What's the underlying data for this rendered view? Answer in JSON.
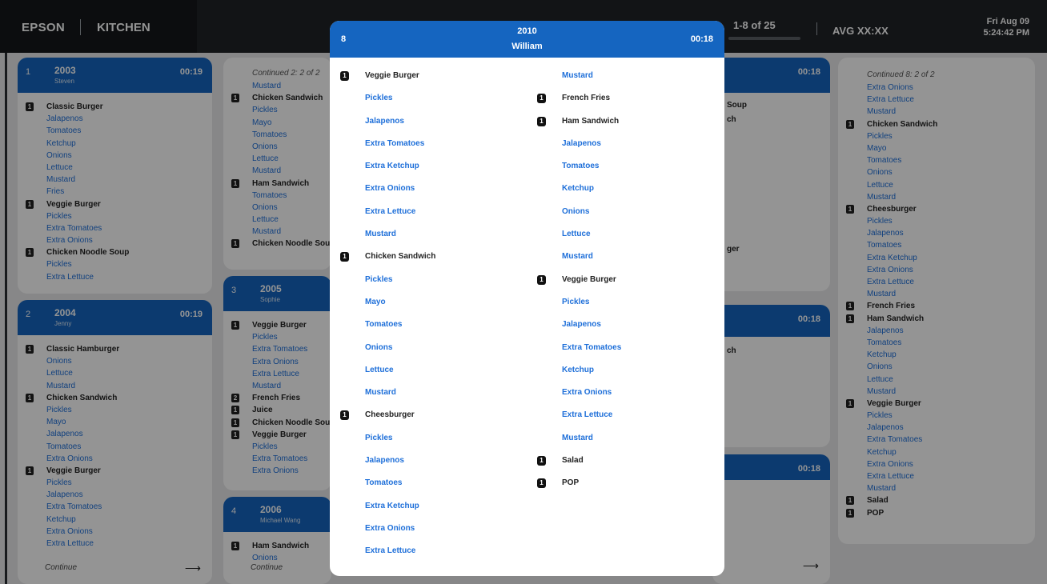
{
  "header": {
    "brand": "EPSON",
    "station": "KITCHEN",
    "pager": "1-8 of 25",
    "avg": "AVG XX:XX",
    "date": "Fri Aug 09",
    "time": "5:24:42 PM"
  },
  "tickets": {
    "t2003": {
      "index": "1",
      "number": "2003",
      "name": "Steven",
      "timer": "00:19",
      "lines": [
        {
          "type": "item",
          "qty": "1",
          "text": "Classic Burger"
        },
        {
          "type": "mod",
          "text": "Jalapenos"
        },
        {
          "type": "mod",
          "text": "Tomatoes"
        },
        {
          "type": "mod",
          "text": "Ketchup"
        },
        {
          "type": "mod",
          "text": "Onions"
        },
        {
          "type": "mod",
          "text": "Lettuce"
        },
        {
          "type": "mod",
          "text": "Mustard"
        },
        {
          "type": "mod",
          "text": "Fries"
        },
        {
          "type": "item",
          "qty": "1",
          "text": "Veggie Burger"
        },
        {
          "type": "mod",
          "text": "Pickles"
        },
        {
          "type": "mod",
          "text": "Extra Tomatoes"
        },
        {
          "type": "mod",
          "text": "Extra Onions"
        },
        {
          "type": "item",
          "qty": "1",
          "text": "Chicken Noodle Soup"
        },
        {
          "type": "mod",
          "text": "Pickles"
        },
        {
          "type": "mod",
          "text": "Extra Lettuce"
        }
      ]
    },
    "t2004": {
      "index": "2",
      "number": "2004",
      "name": "Jenny",
      "timer": "00:19",
      "continue_label": "Continue",
      "arrow": "⟶",
      "lines": [
        {
          "type": "item",
          "qty": "1",
          "text": "Classic Hamburger"
        },
        {
          "type": "mod",
          "text": "Onions"
        },
        {
          "type": "mod",
          "text": "Lettuce"
        },
        {
          "type": "mod",
          "text": "Mustard"
        },
        {
          "type": "item",
          "qty": "1",
          "text": "Chicken Sandwich"
        },
        {
          "type": "mod",
          "text": "Pickles"
        },
        {
          "type": "mod",
          "text": "Mayo"
        },
        {
          "type": "mod",
          "text": "Jalapenos"
        },
        {
          "type": "mod",
          "text": "Tomatoes"
        },
        {
          "type": "mod",
          "text": "Extra Onions"
        },
        {
          "type": "item",
          "qty": "1",
          "text": "Veggie Burger"
        },
        {
          "type": "mod",
          "text": "Pickles"
        },
        {
          "type": "mod",
          "text": "Jalapenos"
        },
        {
          "type": "mod",
          "text": "Extra Tomatoes"
        },
        {
          "type": "mod",
          "text": "Ketchup"
        },
        {
          "type": "mod",
          "text": "Extra Onions"
        },
        {
          "type": "mod",
          "text": "Extra Lettuce"
        }
      ]
    },
    "cont2": {
      "label": "Continued 2: 2 of 2",
      "lines": [
        {
          "type": "mod",
          "text": "Mustard"
        },
        {
          "type": "item",
          "qty": "1",
          "text": "Chicken Sandwich"
        },
        {
          "type": "mod",
          "text": "Pickles"
        },
        {
          "type": "mod",
          "text": "Mayo"
        },
        {
          "type": "mod",
          "text": "Tomatoes"
        },
        {
          "type": "mod",
          "text": "Onions"
        },
        {
          "type": "mod",
          "text": "Lettuce"
        },
        {
          "type": "mod",
          "text": "Mustard"
        },
        {
          "type": "item",
          "qty": "1",
          "text": "Ham Sandwich"
        },
        {
          "type": "mod",
          "text": "Tomatoes"
        },
        {
          "type": "mod",
          "text": "Onions"
        },
        {
          "type": "mod",
          "text": "Lettuce"
        },
        {
          "type": "mod",
          "text": "Mustard"
        },
        {
          "type": "item",
          "qty": "1",
          "text": "Chicken Noodle Soup"
        }
      ]
    },
    "t2005": {
      "index": "3",
      "number": "2005",
      "name": "Sophie",
      "lines": [
        {
          "type": "item",
          "qty": "1",
          "text": "Veggie Burger"
        },
        {
          "type": "mod",
          "text": "Pickles"
        },
        {
          "type": "mod",
          "text": "Extra Tomatoes"
        },
        {
          "type": "mod",
          "text": "Extra Onions"
        },
        {
          "type": "mod",
          "text": "Extra Lettuce"
        },
        {
          "type": "mod",
          "text": "Mustard"
        },
        {
          "type": "item",
          "qty": "2",
          "text": "French Fries"
        },
        {
          "type": "item",
          "qty": "1",
          "text": "Juice"
        },
        {
          "type": "item",
          "qty": "1",
          "text": "Chicken Noodle Soup"
        },
        {
          "type": "item",
          "qty": "1",
          "text": "Veggie Burger"
        },
        {
          "type": "mod",
          "text": "Pickles"
        },
        {
          "type": "mod",
          "text": "Extra Tomatoes"
        },
        {
          "type": "mod",
          "text": "Extra Onions"
        }
      ]
    },
    "t2006": {
      "index": "4",
      "number": "2006",
      "name": "Michael Wang",
      "continue_label": "Continue",
      "lines": [
        {
          "type": "item",
          "qty": "1",
          "text": "Ham Sandwich"
        },
        {
          "type": "mod",
          "text": "Onions"
        }
      ]
    },
    "col3a": {
      "timer": "00:18",
      "lines": [
        {
          "type": "item",
          "text": "Soup"
        },
        {
          "type": "item",
          "text": "ch"
        }
      ],
      "extra": "ger"
    },
    "col3b": {
      "timer": "00:18",
      "fragment": "ch"
    },
    "col3c": {
      "timer": "00:18",
      "arrow": "⟶"
    },
    "cont8": {
      "label": "Continued 8: 2 of 2",
      "lines": [
        {
          "type": "mod",
          "text": "Extra Onions"
        },
        {
          "type": "mod",
          "text": "Extra Lettuce"
        },
        {
          "type": "mod",
          "text": "Mustard"
        },
        {
          "type": "item",
          "qty": "1",
          "text": "Chicken Sandwich"
        },
        {
          "type": "mod",
          "text": "Pickles"
        },
        {
          "type": "mod",
          "text": "Mayo"
        },
        {
          "type": "mod",
          "text": "Tomatoes"
        },
        {
          "type": "mod",
          "text": "Onions"
        },
        {
          "type": "mod",
          "text": "Lettuce"
        },
        {
          "type": "mod",
          "text": "Mustard"
        },
        {
          "type": "item",
          "qty": "1",
          "text": "Cheesburger"
        },
        {
          "type": "mod",
          "text": "Pickles"
        },
        {
          "type": "mod",
          "text": "Jalapenos"
        },
        {
          "type": "mod",
          "text": "Tomatoes"
        },
        {
          "type": "mod",
          "text": "Extra Ketchup"
        },
        {
          "type": "mod",
          "text": "Extra Onions"
        },
        {
          "type": "mod",
          "text": "Extra Lettuce"
        },
        {
          "type": "mod",
          "text": "Mustard"
        },
        {
          "type": "item",
          "qty": "1",
          "text": "French Fries"
        },
        {
          "type": "item",
          "qty": "1",
          "text": "Ham Sandwich"
        },
        {
          "type": "mod",
          "text": "Jalapenos"
        },
        {
          "type": "mod",
          "text": "Tomatoes"
        },
        {
          "type": "mod",
          "text": "Ketchup"
        },
        {
          "type": "mod",
          "text": "Onions"
        },
        {
          "type": "mod",
          "text": "Lettuce"
        },
        {
          "type": "mod",
          "text": "Mustard"
        },
        {
          "type": "item",
          "qty": "1",
          "text": "Veggie Burger"
        },
        {
          "type": "mod",
          "text": "Pickles"
        },
        {
          "type": "mod",
          "text": "Jalapenos"
        },
        {
          "type": "mod",
          "text": "Extra Tomatoes"
        },
        {
          "type": "mod",
          "text": "Ketchup"
        },
        {
          "type": "mod",
          "text": "Extra Onions"
        },
        {
          "type": "mod",
          "text": "Extra Lettuce"
        },
        {
          "type": "mod",
          "text": "Mustard"
        },
        {
          "type": "item",
          "qty": "1",
          "text": "Salad"
        },
        {
          "type": "item",
          "qty": "1",
          "text": "POP"
        }
      ]
    }
  },
  "modal": {
    "index": "8",
    "number": "2010",
    "name": "William",
    "timer": "00:18",
    "left": [
      {
        "type": "item",
        "qty": "1",
        "text": "Veggie Burger"
      },
      {
        "type": "mod",
        "text": "Pickles"
      },
      {
        "type": "mod",
        "text": "Jalapenos"
      },
      {
        "type": "mod",
        "text": "Extra Tomatoes"
      },
      {
        "type": "mod",
        "text": "Extra Ketchup"
      },
      {
        "type": "mod",
        "text": "Extra Onions"
      },
      {
        "type": "mod",
        "text": "Extra Lettuce"
      },
      {
        "type": "mod",
        "text": "Mustard"
      },
      {
        "type": "item",
        "qty": "1",
        "text": "Chicken Sandwich"
      },
      {
        "type": "mod",
        "text": "Pickles"
      },
      {
        "type": "mod",
        "text": "Mayo"
      },
      {
        "type": "mod",
        "text": "Tomatoes"
      },
      {
        "type": "mod",
        "text": "Onions"
      },
      {
        "type": "mod",
        "text": "Lettuce"
      },
      {
        "type": "mod",
        "text": "Mustard"
      },
      {
        "type": "item",
        "qty": "1",
        "text": "Cheesburger"
      },
      {
        "type": "mod",
        "text": "Pickles"
      },
      {
        "type": "mod",
        "text": "Jalapenos"
      },
      {
        "type": "mod",
        "text": "Tomatoes"
      },
      {
        "type": "mod",
        "text": "Extra Ketchup"
      },
      {
        "type": "mod",
        "text": "Extra Onions"
      },
      {
        "type": "mod",
        "text": "Extra Lettuce"
      }
    ],
    "right": [
      {
        "type": "mod",
        "text": "Mustard"
      },
      {
        "type": "item",
        "qty": "1",
        "text": "French Fries"
      },
      {
        "type": "item",
        "qty": "1",
        "text": "Ham Sandwich"
      },
      {
        "type": "mod",
        "text": "Jalapenos"
      },
      {
        "type": "mod",
        "text": "Tomatoes"
      },
      {
        "type": "mod",
        "text": "Ketchup"
      },
      {
        "type": "mod",
        "text": "Onions"
      },
      {
        "type": "mod",
        "text": "Lettuce"
      },
      {
        "type": "mod",
        "text": "Mustard"
      },
      {
        "type": "item",
        "qty": "1",
        "text": "Veggie Burger"
      },
      {
        "type": "mod",
        "text": "Pickles"
      },
      {
        "type": "mod",
        "text": "Jalapenos"
      },
      {
        "type": "mod",
        "text": "Extra Tomatoes"
      },
      {
        "type": "mod",
        "text": "Ketchup"
      },
      {
        "type": "mod",
        "text": "Extra Onions"
      },
      {
        "type": "mod",
        "text": "Extra Lettuce"
      },
      {
        "type": "mod",
        "text": "Mustard"
      },
      {
        "type": "item",
        "qty": "1",
        "text": "Salad"
      },
      {
        "type": "item",
        "qty": "1",
        "text": "POP"
      }
    ]
  },
  "colors": {
    "header_blue": "#1565c0",
    "modifier_blue": "#1e6fd9",
    "topbar": "#1f2327"
  }
}
